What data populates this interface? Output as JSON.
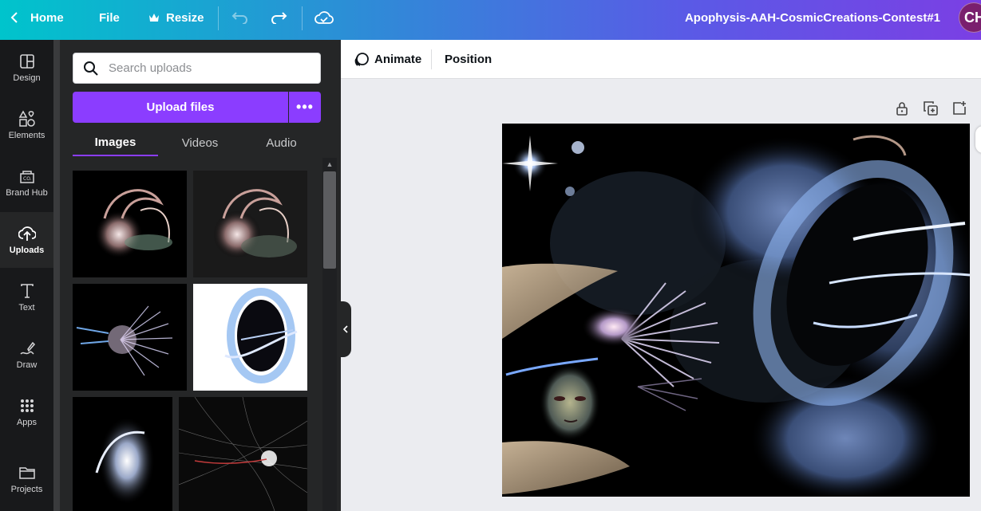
{
  "topbar": {
    "home_label": "Home",
    "file_label": "File",
    "resize_label": "Resize",
    "title": "Apophysis-AAH-CosmicCreations-Contest#1",
    "avatar_initials": "CH"
  },
  "rail": {
    "items": [
      {
        "label": "Design",
        "icon": "design-icon"
      },
      {
        "label": "Elements",
        "icon": "elements-icon"
      },
      {
        "label": "Brand Hub",
        "icon": "brand-hub-icon"
      },
      {
        "label": "Uploads",
        "icon": "uploads-icon"
      },
      {
        "label": "Text",
        "icon": "text-icon"
      },
      {
        "label": "Draw",
        "icon": "draw-icon"
      },
      {
        "label": "Apps",
        "icon": "apps-icon"
      },
      {
        "label": "Projects",
        "icon": "projects-icon"
      }
    ],
    "active": "Uploads"
  },
  "panel": {
    "search_placeholder": "Search uploads",
    "upload_label": "Upload files",
    "more_label": "•••",
    "tabs": [
      {
        "label": "Images"
      },
      {
        "label": "Videos"
      },
      {
        "label": "Audio"
      }
    ],
    "active_tab": "Images"
  },
  "canvas_toolbar": {
    "animate_label": "Animate",
    "position_label": "Position"
  },
  "colors": {
    "accent": "#8b3dff",
    "rail_bg": "#18191b",
    "panel_bg": "#252627",
    "canvas_bg": "#ebecf0"
  }
}
